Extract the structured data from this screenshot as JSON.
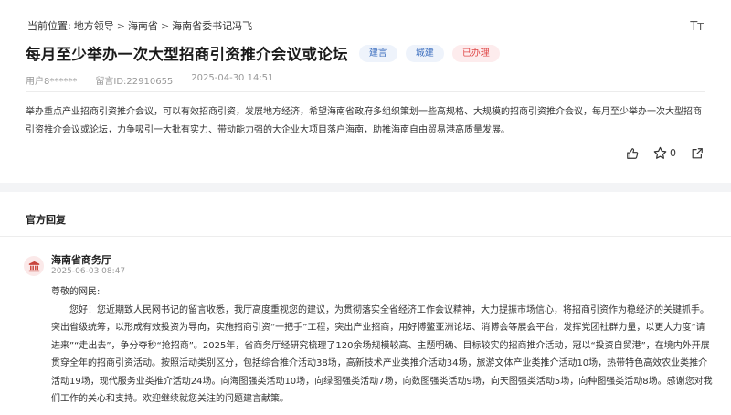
{
  "breadcrumb": {
    "prefix": "当前位置:",
    "items": [
      "地方领导",
      "海南省",
      "海南省委书记冯飞"
    ],
    "separator": ">"
  },
  "font_toggle": {
    "small": "T",
    "big": "T"
  },
  "message": {
    "title": "每月至少举办一次大型招商引资推介会议或论坛",
    "tags": [
      "建言",
      "城建",
      "已办理"
    ],
    "user": "用户8******",
    "message_id": "留言ID:22910655",
    "time": "2025-04-30 14:51",
    "content": "举办重点产业招商引资推介会议，可以有效招商引资，发展地方经济，希望海南省政府多组织策划一些高规格、大规模的招商引资推介会议，每月至少举办一次大型招商引资推介会议或论坛，力争吸引一大批有实力、带动能力强的大企业大项目落户海南，助推海南自由贸易港高质量发展。",
    "star_count": "0"
  },
  "reply_section": {
    "title": "官方回复",
    "department": "海南省商务厅",
    "time": "2025-06-03 08:47",
    "greeting": "尊敬的网民:",
    "body": "您好！您近期致人民网书记的留言收悉，我厅高度重视您的建议，为贯彻落实全省经济工作会议精神，大力提振市场信心，将招商引资作为稳经济的关键抓手。突出省级统筹，以形成有效投资为导向，实施招商引资“一把手”工程，突出产业招商，用好博鳌亚洲论坛、消博会等展会平台，发挥党团社群力量，以更大力度“请进来”“走出去”，争分夺秒“抢招商”。2025年，省商务厅经研究梳理了120余场规模较高、主题明确、目标较实的招商推介活动，冠以“投资自贸港”，在境内外开展贯穿全年的招商引资活动。按照活动类别区分，包括综合推介活动38场，高新技术产业类推介活动34场，旅游文体产业类推介活动10场，热带特色高效农业类推介活动19场，现代服务业类推介活动24场。向海图强类活动10场，向绿图强类活动7场，向数图强类活动9场，向天图强类活动5场，向种图强类活动8场。感谢您对我们工作的关心和支持。欢迎继续就您关注的问题建言献策。"
  },
  "colors": {
    "tag_blue": "#3d6fbf",
    "tag_red": "#e04a4a",
    "dept_icon": "#c8443c"
  }
}
